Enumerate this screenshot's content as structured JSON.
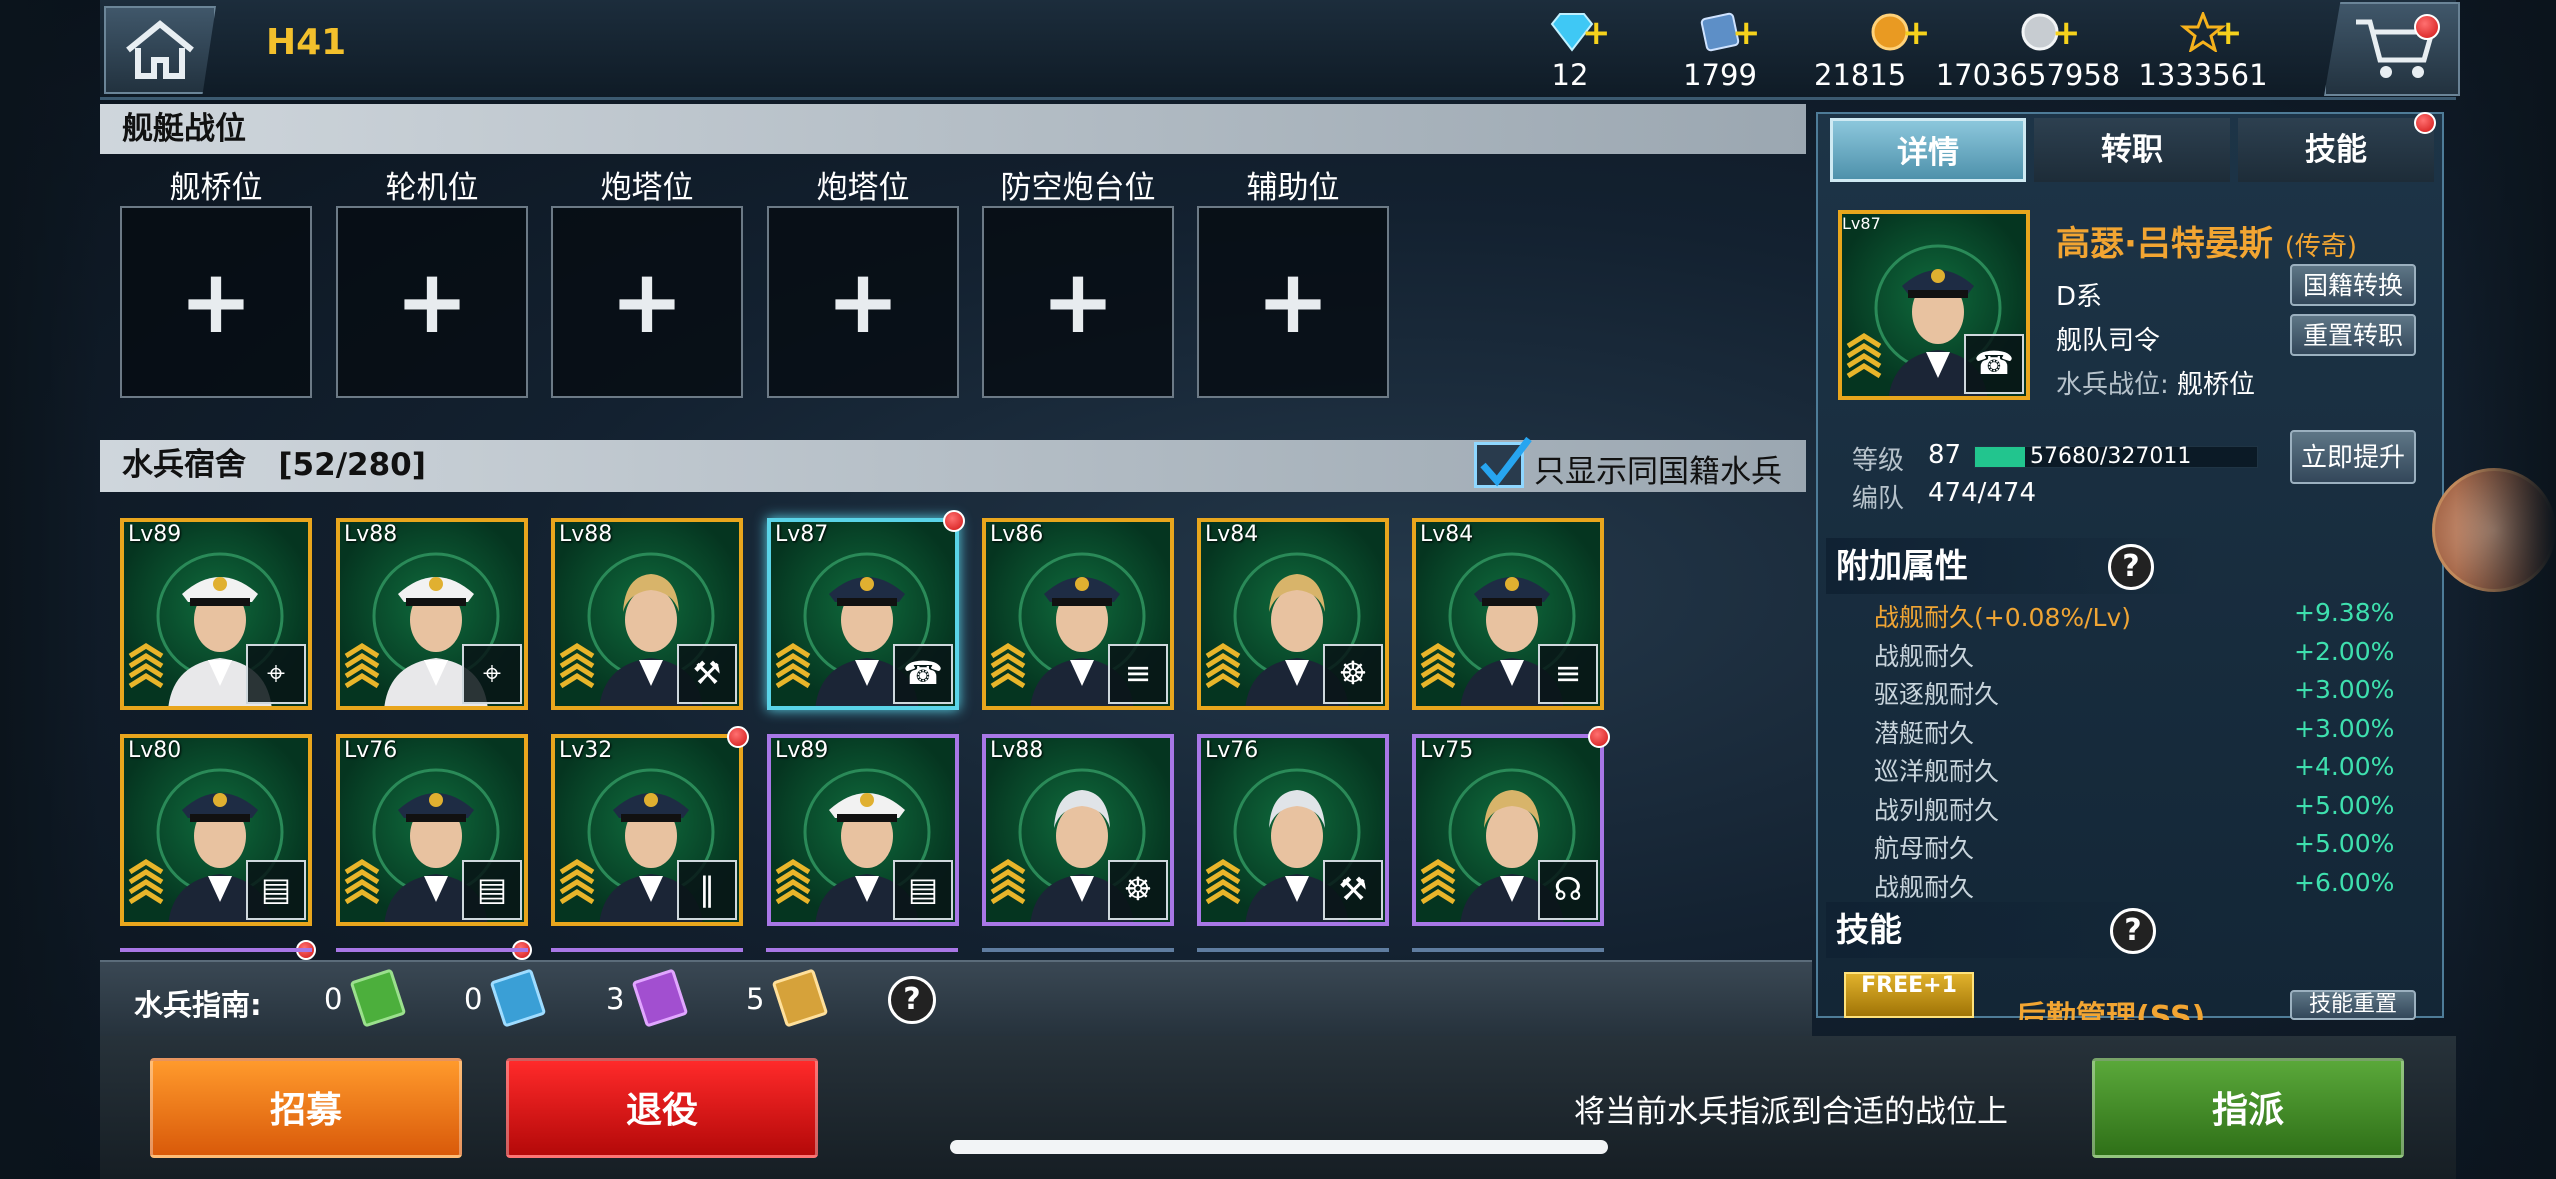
{
  "header": {
    "player_name": "H41",
    "resources": [
      {
        "icon": "diamond-icon",
        "value": "12"
      },
      {
        "icon": "blueprint-icon",
        "value": "1799"
      },
      {
        "icon": "gold-coin-icon",
        "value": "21815"
      },
      {
        "icon": "silver-coin-icon",
        "value": "1703657958"
      },
      {
        "icon": "star-icon",
        "value": "1333561"
      }
    ]
  },
  "positions": {
    "title": "舰艇战位",
    "slots": [
      "舰桥位",
      "轮机位",
      "炮塔位",
      "炮塔位",
      "防空炮台位",
      "辅助位"
    ],
    "empty_symbol": "+"
  },
  "barracks": {
    "title": "水兵宿舍",
    "count": "[52/280]",
    "filter_label": "只显示同国籍水兵",
    "sailors": [
      {
        "level": "Lv89",
        "frame": "gold",
        "role_icon": "radar-icon",
        "role_glyph": "⌖"
      },
      {
        "level": "Lv88",
        "frame": "gold",
        "role_icon": "radar-icon",
        "role_glyph": "⌖"
      },
      {
        "level": "Lv88",
        "frame": "gold",
        "role_icon": "engineer-icon",
        "role_glyph": "⚒"
      },
      {
        "level": "Lv87",
        "frame": "gold",
        "role_icon": "radio-icon",
        "role_glyph": "☎"
      },
      {
        "level": "Lv86",
        "frame": "gold",
        "role_icon": "torpedo-icon",
        "role_glyph": "≡"
      },
      {
        "level": "Lv84",
        "frame": "gold",
        "role_icon": "helm-icon",
        "role_glyph": "☸"
      },
      {
        "level": "Lv84",
        "frame": "gold",
        "role_icon": "torpedo-icon",
        "role_glyph": "≡"
      },
      {
        "level": "Lv80",
        "frame": "gold",
        "role_icon": "turret-icon",
        "role_glyph": "▤"
      },
      {
        "level": "Lv76",
        "frame": "gold",
        "role_icon": "turret-icon",
        "role_glyph": "▤"
      },
      {
        "level": "Lv32",
        "frame": "gold",
        "role_icon": "shell-icon",
        "role_glyph": "‖"
      },
      {
        "level": "Lv89",
        "frame": "purple",
        "role_icon": "turret-icon",
        "role_glyph": "▤"
      },
      {
        "level": "Lv88",
        "frame": "purple",
        "role_icon": "helm-icon",
        "role_glyph": "☸"
      },
      {
        "level": "Lv76",
        "frame": "purple",
        "role_icon": "tools-icon",
        "role_glyph": "⚒"
      },
      {
        "level": "Lv75",
        "frame": "purple",
        "role_icon": "headset-icon",
        "role_glyph": "☊"
      }
    ]
  },
  "guides": {
    "title": "水兵指南:",
    "items": [
      {
        "count": "0",
        "color": "#4caf3c"
      },
      {
        "count": "0",
        "color": "#3a9fd6"
      },
      {
        "count": "3",
        "color": "#a24fd0"
      },
      {
        "count": "5",
        "color": "#d6a23a"
      }
    ]
  },
  "detail": {
    "tabs": [
      "详情",
      "转职",
      "技能"
    ],
    "officer": {
      "level": "Lv87",
      "name": "高瑟·吕特晏斯",
      "rarity": "(传奇)",
      "faction": "D系",
      "role": "舰队司令",
      "position_label": "水兵战位:",
      "position": "舰桥位",
      "btn_nationality": "国籍转换",
      "btn_reset": "重置转职"
    },
    "level_label": "等级",
    "level_value": "87",
    "xp": "57680/327011",
    "xp_fraction": 0.176,
    "upgrade_label": "立即提升",
    "fleet_label": "编队",
    "fleet_value": "474/474",
    "attr_title": "附加属性",
    "attributes": [
      {
        "name": "战舰耐久(+0.08%/Lv)",
        "value": "+9.38%",
        "highlight": true
      },
      {
        "name": "战舰耐久",
        "value": "+2.00%",
        "highlight": false
      },
      {
        "name": "驱逐舰耐久",
        "value": "+3.00%",
        "highlight": false
      },
      {
        "name": "潜艇耐久",
        "value": "+3.00%",
        "highlight": false
      },
      {
        "name": "巡洋舰耐久",
        "value": "+4.00%",
        "highlight": false
      },
      {
        "name": "战列舰耐久",
        "value": "+5.00%",
        "highlight": false
      },
      {
        "name": "航母耐久",
        "value": "+5.00%",
        "highlight": false
      },
      {
        "name": "战舰耐久",
        "value": "+6.00%",
        "highlight": false
      }
    ],
    "skill_title": "技能",
    "skill_badge": "FREE+1",
    "skill_name": "后勤管理(SS)",
    "skill_btn": "技能重置"
  },
  "bottom": {
    "recruit": "招募",
    "retire": "退役",
    "hint": "将当前水兵指派到合适的战位上",
    "assign": "指派"
  },
  "help_symbol": "?"
}
